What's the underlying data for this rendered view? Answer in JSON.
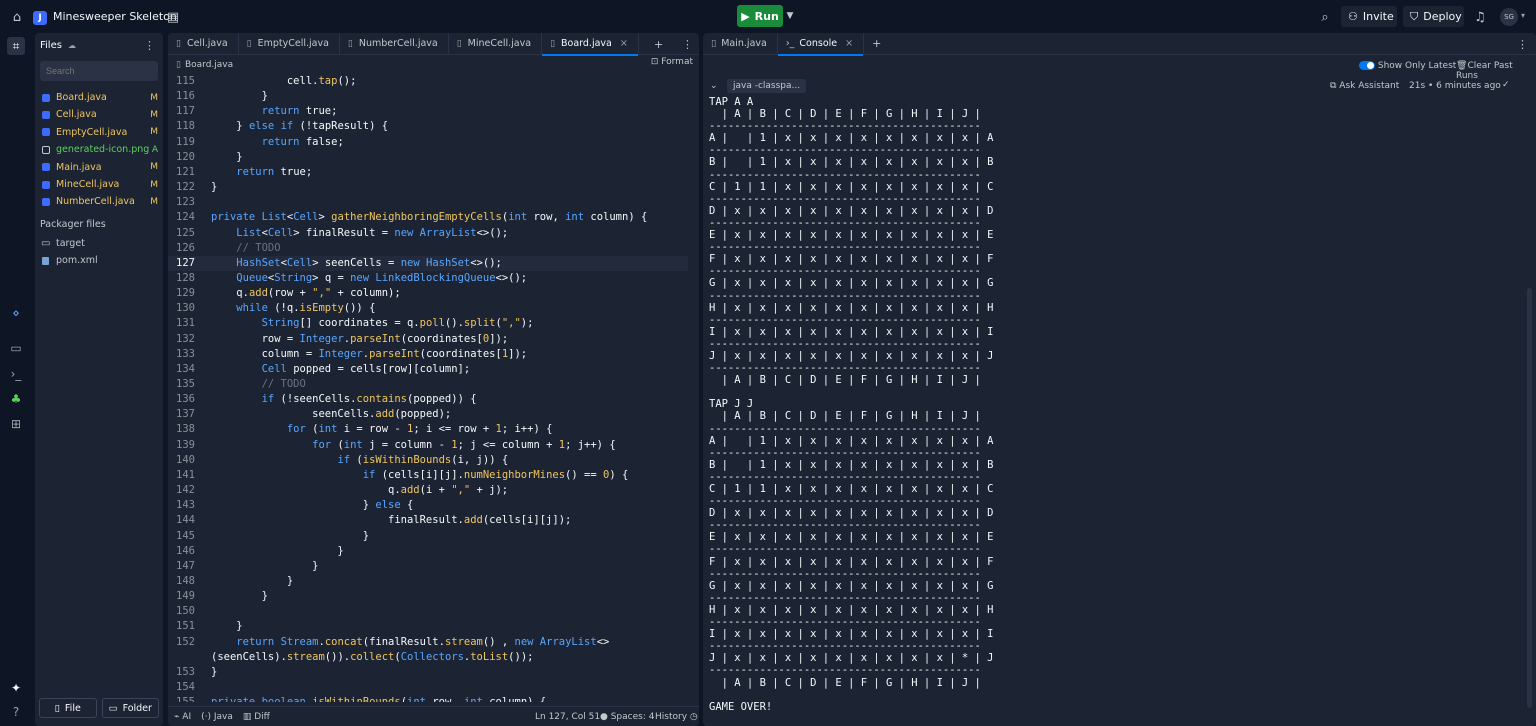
{
  "topbar": {
    "project_name": "Minesweeper Skeleton",
    "run_label": "Run",
    "invite_label": "Invite",
    "deploy_label": "Deploy",
    "avatar_initials": "SG"
  },
  "sidebar": {
    "title": "Files",
    "search_placeholder": "Search",
    "files": [
      {
        "name": "Board.java",
        "badge": "M",
        "color": "#f0c65e"
      },
      {
        "name": "Cell.java",
        "badge": "M",
        "color": "#f0c65e"
      },
      {
        "name": "EmptyCell.java",
        "badge": "M",
        "color": "#f0c65e"
      },
      {
        "name": "generated-icon.png",
        "badge": "A",
        "color": "#5bd15b"
      },
      {
        "name": "Main.java",
        "badge": "M",
        "color": "#f0c65e"
      },
      {
        "name": "MineCell.java",
        "badge": "M",
        "color": "#f0c65e"
      },
      {
        "name": "NumberCell.java",
        "badge": "M",
        "color": "#f0c65e"
      }
    ],
    "packager_label": "Packager files",
    "packager_items": [
      {
        "name": "target",
        "kind": "folder"
      },
      {
        "name": "pom.xml",
        "kind": "file"
      }
    ],
    "new_file_label": "File",
    "new_folder_label": "Folder"
  },
  "editor": {
    "tabs": [
      "Cell.java",
      "EmptyCell.java",
      "NumberCell.java",
      "MineCell.java",
      "Board.java"
    ],
    "active_tab": 4,
    "breadcrumb": "Board.java",
    "format_label": "Format",
    "current_line": 127,
    "code_lines": [
      {
        "n": "115",
        "t": "            cell.tap();"
      },
      {
        "n": "116",
        "t": "        }"
      },
      {
        "n": "117",
        "t": "        return true;"
      },
      {
        "n": "118",
        "t": "    } else if (!tapResult) {"
      },
      {
        "n": "119",
        "t": "        return false;"
      },
      {
        "n": "120",
        "t": "    }"
      },
      {
        "n": "121",
        "t": "    return true;"
      },
      {
        "n": "122",
        "t": "}"
      },
      {
        "n": "123",
        "t": ""
      },
      {
        "n": "124",
        "t": "private List<Cell> gatherNeighboringEmptyCells(int row, int column) {"
      },
      {
        "n": "125",
        "t": "    List<Cell> finalResult = new ArrayList<>();"
      },
      {
        "n": "126",
        "t": "    // TODO"
      },
      {
        "n": "127",
        "t": "    HashSet<Cell> seenCells = new HashSet<>();"
      },
      {
        "n": "128",
        "t": "    Queue<String> q = new LinkedBlockingQueue<>();"
      },
      {
        "n": "129",
        "t": "    q.add(row + \",\" + column);"
      },
      {
        "n": "130",
        "t": "    while (!q.isEmpty()) {"
      },
      {
        "n": "131",
        "t": "        String[] coordinates = q.poll().split(\",\");"
      },
      {
        "n": "132",
        "t": "        row = Integer.parseInt(coordinates[0]);"
      },
      {
        "n": "133",
        "t": "        column = Integer.parseInt(coordinates[1]);"
      },
      {
        "n": "134",
        "t": "        Cell popped = cells[row][column];"
      },
      {
        "n": "135",
        "t": "        // TODO"
      },
      {
        "n": "136",
        "t": "        if (!seenCells.contains(popped)) {"
      },
      {
        "n": "137",
        "t": "                seenCells.add(popped);"
      },
      {
        "n": "138",
        "t": "            for (int i = row - 1; i <= row + 1; i++) {"
      },
      {
        "n": "139",
        "t": "                for (int j = column - 1; j <= column + 1; j++) {"
      },
      {
        "n": "140",
        "t": "                    if (isWithinBounds(i, j)) {"
      },
      {
        "n": "141",
        "t": "                        if (cells[i][j].numNeighborMines() == 0) {"
      },
      {
        "n": "142",
        "t": "                            q.add(i + \",\" + j);"
      },
      {
        "n": "143",
        "t": "                        } else {"
      },
      {
        "n": "144",
        "t": "                            finalResult.add(cells[i][j]);"
      },
      {
        "n": "145",
        "t": "                        }"
      },
      {
        "n": "146",
        "t": "                    }"
      },
      {
        "n": "147",
        "t": "                }"
      },
      {
        "n": "148",
        "t": "            }"
      },
      {
        "n": "149",
        "t": "        }"
      },
      {
        "n": "150",
        "t": ""
      },
      {
        "n": "151",
        "t": "    }"
      },
      {
        "n": "152",
        "t": "    return Stream.concat(finalResult.stream() , new ArrayList<>"
      },
      {
        "n": "",
        "t": "(seenCells).stream()).collect(Collectors.toList());"
      },
      {
        "n": "153",
        "t": "}"
      },
      {
        "n": "154",
        "t": ""
      },
      {
        "n": "155",
        "t": "private boolean isWithinBounds(int row, int column) {"
      }
    ],
    "status": {
      "ai": "AI",
      "lang": "Java",
      "diff": "Diff",
      "position": "Ln 127, Col 51",
      "spaces": "Spaces: 4",
      "history": "History"
    }
  },
  "console": {
    "tabs": [
      "Main.java",
      "Console"
    ],
    "active_tab": 1,
    "show_only_latest": "Show Only Latest",
    "clear_past_runs": "Clear Past Runs",
    "run_command": "java -classpa...",
    "ask_assistant": "Ask Assistant",
    "run_time": "21s • 6 minutes ago",
    "output": "TAP A A\n  | A | B | C | D | E | F | G | H | I | J |\n-------------------------------------------\nA |   | 1 | x | x | x | x | x | x | x | x | A\n-------------------------------------------\nB |   | 1 | x | x | x | x | x | x | x | x | B\n-------------------------------------------\nC | 1 | 1 | x | x | x | x | x | x | x | x | C\n-------------------------------------------\nD | x | x | x | x | x | x | x | x | x | x | D\n-------------------------------------------\nE | x | x | x | x | x | x | x | x | x | x | E\n-------------------------------------------\nF | x | x | x | x | x | x | x | x | x | x | F\n-------------------------------------------\nG | x | x | x | x | x | x | x | x | x | x | G\n-------------------------------------------\nH | x | x | x | x | x | x | x | x | x | x | H\n-------------------------------------------\nI | x | x | x | x | x | x | x | x | x | x | I\n-------------------------------------------\nJ | x | x | x | x | x | x | x | x | x | x | J\n-------------------------------------------\n  | A | B | C | D | E | F | G | H | I | J |\n\nTAP J J\n  | A | B | C | D | E | F | G | H | I | J |\n-------------------------------------------\nA |   | 1 | x | x | x | x | x | x | x | x | A\n-------------------------------------------\nB |   | 1 | x | x | x | x | x | x | x | x | B\n-------------------------------------------\nC | 1 | 1 | x | x | x | x | x | x | x | x | C\n-------------------------------------------\nD | x | x | x | x | x | x | x | x | x | x | D\n-------------------------------------------\nE | x | x | x | x | x | x | x | x | x | x | E\n-------------------------------------------\nF | x | x | x | x | x | x | x | x | x | x | F\n-------------------------------------------\nG | x | x | x | x | x | x | x | x | x | x | G\n-------------------------------------------\nH | x | x | x | x | x | x | x | x | x | x | H\n-------------------------------------------\nI | x | x | x | x | x | x | x | x | x | x | I\n-------------------------------------------\nJ | x | x | x | x | x | x | x | x | x | * | J\n-------------------------------------------\n  | A | B | C | D | E | F | G | H | I | J |\n\nGAME OVER!"
  }
}
